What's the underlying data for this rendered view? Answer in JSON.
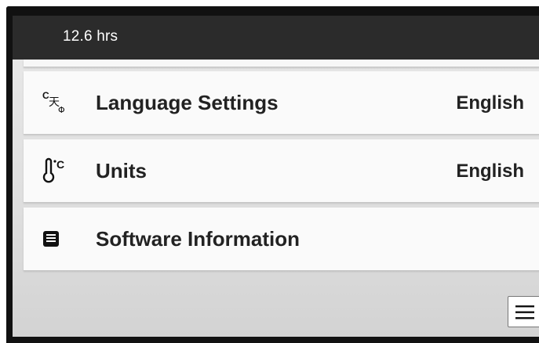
{
  "header": {
    "time_text": "12.6 hrs"
  },
  "settings": {
    "items": [
      {
        "label": "Language Settings",
        "value": "English",
        "icon": "language-icon"
      },
      {
        "label": "Units",
        "value": "English",
        "icon": "thermometer-celsius-icon"
      },
      {
        "label": "Software Information",
        "value": "",
        "icon": "document-icon"
      }
    ]
  },
  "menu": {
    "icon": "hamburger-menu-icon"
  },
  "colors": {
    "header_bg": "#2b2b2b",
    "header_text": "#ffffff",
    "row_bg": "#fafafa",
    "screen_bg": "#e4e4e4",
    "text": "#222222"
  }
}
